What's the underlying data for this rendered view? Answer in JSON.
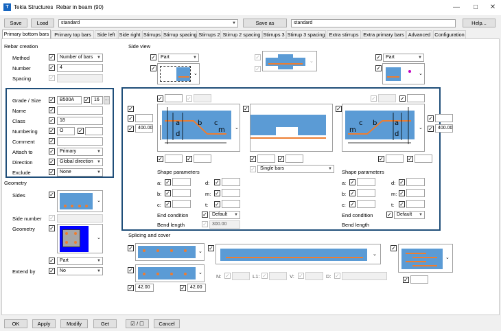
{
  "window": {
    "app": "Tekla Structures",
    "title": "Rebar in beam (90)"
  },
  "toolbar": {
    "save": "Save",
    "load": "Load",
    "preset": "standard",
    "save_as": "Save as",
    "save_as_name": "standard",
    "help": "Help..."
  },
  "tabs": [
    "Primary bottom bars",
    "Primary top bars",
    "Side left",
    "Side right",
    "Stirrups",
    "Stirrup spacing",
    "Stirrups 2",
    "Stirrup 2 spacing",
    "Stirrups 3",
    "Stirrup 3 spacing",
    "Extra stirrups",
    "Extra primary bars",
    "Advanced",
    "Configuration"
  ],
  "rebar": {
    "section": "Rebar creation",
    "method_label": "Method",
    "method": "Number of bars",
    "number_label": "Number",
    "number": "4",
    "spacing_label": "Spacing",
    "spacing": "",
    "grade_label": "Grade / Size",
    "grade": "B500A",
    "size": "16",
    "name_label": "Name",
    "name": "",
    "class_label": "Class",
    "class": "18",
    "numbering_label": "Numbering",
    "numbering": "O",
    "numbering2": "",
    "comment_label": "Comment",
    "comment": "",
    "attach_label": "Attach to",
    "attach": "Primary",
    "direction_label": "Direction",
    "direction": "Global direction",
    "exclude_label": "Exclude",
    "exclude": "None"
  },
  "geometry": {
    "section": "Geometry",
    "sides_label": "Sides",
    "side_number_label": "Side number",
    "geometry_label": "Geometry",
    "part": "Part",
    "extend_label": "Extend by",
    "extend": "No"
  },
  "side_view": {
    "section": "Side view",
    "part_left": "Part",
    "part_right": "Part",
    "left_value": "400.00",
    "right_value": "400.00",
    "single_bars": "Single bars",
    "shape_params": "Shape parameters",
    "a": "a:",
    "b": "b:",
    "c": "c:",
    "d": "d:",
    "m": "m:",
    "t": "t:",
    "end_condition": "End condition",
    "end_left": "Default",
    "end_right": "Default",
    "bend_length": "Bend length",
    "bend_value": "300.00"
  },
  "splicing": {
    "section": "Splicing and cover",
    "v1": "42.00",
    "v2": "42.00",
    "n": "N:",
    "l1": "L1:",
    "v": "V:",
    "d": "D:"
  },
  "bottom": {
    "ok": "OK",
    "apply": "Apply",
    "modify": "Modify",
    "get": "Get",
    "toggle": "☑ / ☐",
    "cancel": "Cancel"
  },
  "colors": {
    "beam": "#5b9bd5",
    "bar": "#ed7d31",
    "highlight": "#1f4e79"
  }
}
